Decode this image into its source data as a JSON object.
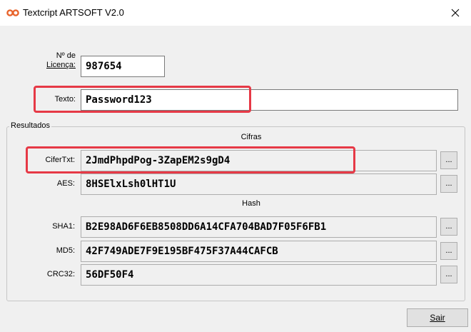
{
  "window": {
    "title": "Textcript ARTSOFT V2.0"
  },
  "license": {
    "label_line1": "Nº de",
    "label_line2": "Licença:",
    "value": "987654"
  },
  "texto": {
    "label": "Texto:",
    "value": "Password123"
  },
  "results": {
    "group_label": "Resultados",
    "cifras_title": "Cifras",
    "hash_title": "Hash",
    "rows": {
      "cifertxt": {
        "label": "CiferTxt:",
        "value": "2JmdPhpdPog-3ZapEM2s9gD4",
        "button": "..."
      },
      "aes": {
        "label": "AES:",
        "value": "8HSElxLsh0lHT1U",
        "button": "..."
      },
      "sha1": {
        "label": "SHA1:",
        "value": "B2E98AD6F6EB8508DD6A14CFA704BAD7F05F6FB1",
        "button": "..."
      },
      "md5": {
        "label": "MD5:",
        "value": "42F749ADE7F9E195BF475F37A44CAFCB",
        "button": "..."
      },
      "crc32": {
        "label": "CRC32:",
        "value": "56DF50F4",
        "button": "..."
      }
    }
  },
  "footer": {
    "exit_label": "Sair"
  },
  "colors": {
    "highlight": "#e63946",
    "window_bg": "#f0f0f0",
    "logo": "#e8632b"
  }
}
